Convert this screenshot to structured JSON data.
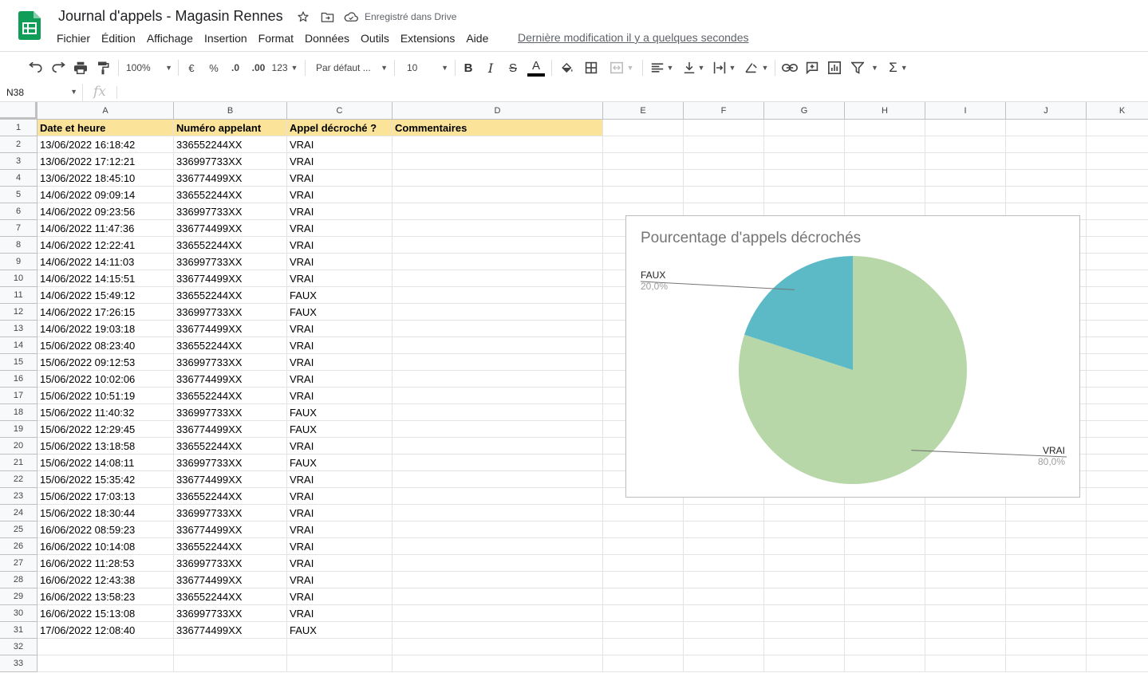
{
  "app": {
    "title": "Journal d'appels - Magasin Rennes",
    "save_status": "Enregistré dans Drive",
    "last_edit": "Dernière modification il y a quelques secondes",
    "menu": [
      "Fichier",
      "Édition",
      "Affichage",
      "Insertion",
      "Format",
      "Données",
      "Outils",
      "Extensions",
      "Aide"
    ]
  },
  "toolbar": {
    "zoom": "100%",
    "currency": "€",
    "percent": "%",
    "dec_less": ".0",
    "dec_more": ".00",
    "more_formats": "123",
    "font": "Par défaut ...",
    "font_size": "10",
    "icons": [
      "undo-icon",
      "redo-icon",
      "print-icon",
      "paint-format-icon",
      "bold-icon",
      "italic-icon",
      "strikethrough-icon",
      "text-color-icon",
      "fill-color-icon",
      "borders-icon",
      "merge-icon",
      "align-icon",
      "valign-icon",
      "wrap-icon",
      "rotate-icon",
      "link-icon",
      "comment-icon",
      "chart-icon",
      "filter-icon",
      "functions-icon"
    ]
  },
  "formula_bar": {
    "name_box": "N38",
    "fx": "fx"
  },
  "sheet": {
    "columns": [
      "A",
      "B",
      "C",
      "D",
      "E",
      "F",
      "G",
      "H",
      "I",
      "J",
      "K"
    ],
    "header": [
      "Date et heure",
      "Numéro appelant",
      "Appel décroché ?",
      "Commentaires"
    ],
    "rows": [
      [
        "13/06/2022 16:18:42",
        "336552244XX",
        "VRAI"
      ],
      [
        "13/06/2022 17:12:21",
        "336997733XX",
        "VRAI"
      ],
      [
        "13/06/2022 18:45:10",
        "336774499XX",
        "VRAI"
      ],
      [
        "14/06/2022 09:09:14",
        "336552244XX",
        "VRAI"
      ],
      [
        "14/06/2022 09:23:56",
        "336997733XX",
        "VRAI"
      ],
      [
        "14/06/2022 11:47:36",
        "336774499XX",
        "VRAI"
      ],
      [
        "14/06/2022 12:22:41",
        "336552244XX",
        "VRAI"
      ],
      [
        "14/06/2022 14:11:03",
        "336997733XX",
        "VRAI"
      ],
      [
        "14/06/2022 14:15:51",
        "336774499XX",
        "VRAI"
      ],
      [
        "14/06/2022 15:49:12",
        "336552244XX",
        "FAUX"
      ],
      [
        "14/06/2022 17:26:15",
        "336997733XX",
        "FAUX"
      ],
      [
        "14/06/2022 19:03:18",
        "336774499XX",
        "VRAI"
      ],
      [
        "15/06/2022 08:23:40",
        "336552244XX",
        "VRAI"
      ],
      [
        "15/06/2022 09:12:53",
        "336997733XX",
        "VRAI"
      ],
      [
        "15/06/2022 10:02:06",
        "336774499XX",
        "VRAI"
      ],
      [
        "15/06/2022 10:51:19",
        "336552244XX",
        "VRAI"
      ],
      [
        "15/06/2022 11:40:32",
        "336997733XX",
        "FAUX"
      ],
      [
        "15/06/2022 12:29:45",
        "336774499XX",
        "FAUX"
      ],
      [
        "15/06/2022 13:18:58",
        "336552244XX",
        "VRAI"
      ],
      [
        "15/06/2022 14:08:11",
        "336997733XX",
        "FAUX"
      ],
      [
        "15/06/2022 15:35:42",
        "336774499XX",
        "VRAI"
      ],
      [
        "15/06/2022 17:03:13",
        "336552244XX",
        "VRAI"
      ],
      [
        "15/06/2022 18:30:44",
        "336997733XX",
        "VRAI"
      ],
      [
        "16/06/2022 08:59:23",
        "336774499XX",
        "VRAI"
      ],
      [
        "16/06/2022 10:14:08",
        "336552244XX",
        "VRAI"
      ],
      [
        "16/06/2022 11:28:53",
        "336997733XX",
        "VRAI"
      ],
      [
        "16/06/2022 12:43:38",
        "336774499XX",
        "VRAI"
      ],
      [
        "16/06/2022 13:58:23",
        "336552244XX",
        "VRAI"
      ],
      [
        "16/06/2022 15:13:08",
        "336997733XX",
        "VRAI"
      ],
      [
        "17/06/2022 12:08:40",
        "336774499XX",
        "FAUX"
      ]
    ],
    "row_numbers": [
      "1",
      "2",
      "3",
      "4",
      "5",
      "6",
      "7",
      "8",
      "9",
      "10",
      "11",
      "12",
      "13",
      "14",
      "15",
      "16",
      "17",
      "18",
      "19",
      "20",
      "21",
      "22",
      "23",
      "24",
      "25",
      "26",
      "27",
      "28",
      "29",
      "30",
      "31",
      "32",
      "33"
    ]
  },
  "chart_data": {
    "type": "pie",
    "title": "Pourcentage d'appels décrochés",
    "slices": [
      {
        "label": "VRAI",
        "value": 80.0,
        "display": "80,0%",
        "color": "#b7d7a8"
      },
      {
        "label": "FAUX",
        "value": 20.0,
        "display": "20,0%",
        "color": "#5bbac6"
      }
    ],
    "legend": "none"
  },
  "colors": {
    "header_fill": "#fbe49a",
    "sheets_green": "#0f9d58"
  }
}
